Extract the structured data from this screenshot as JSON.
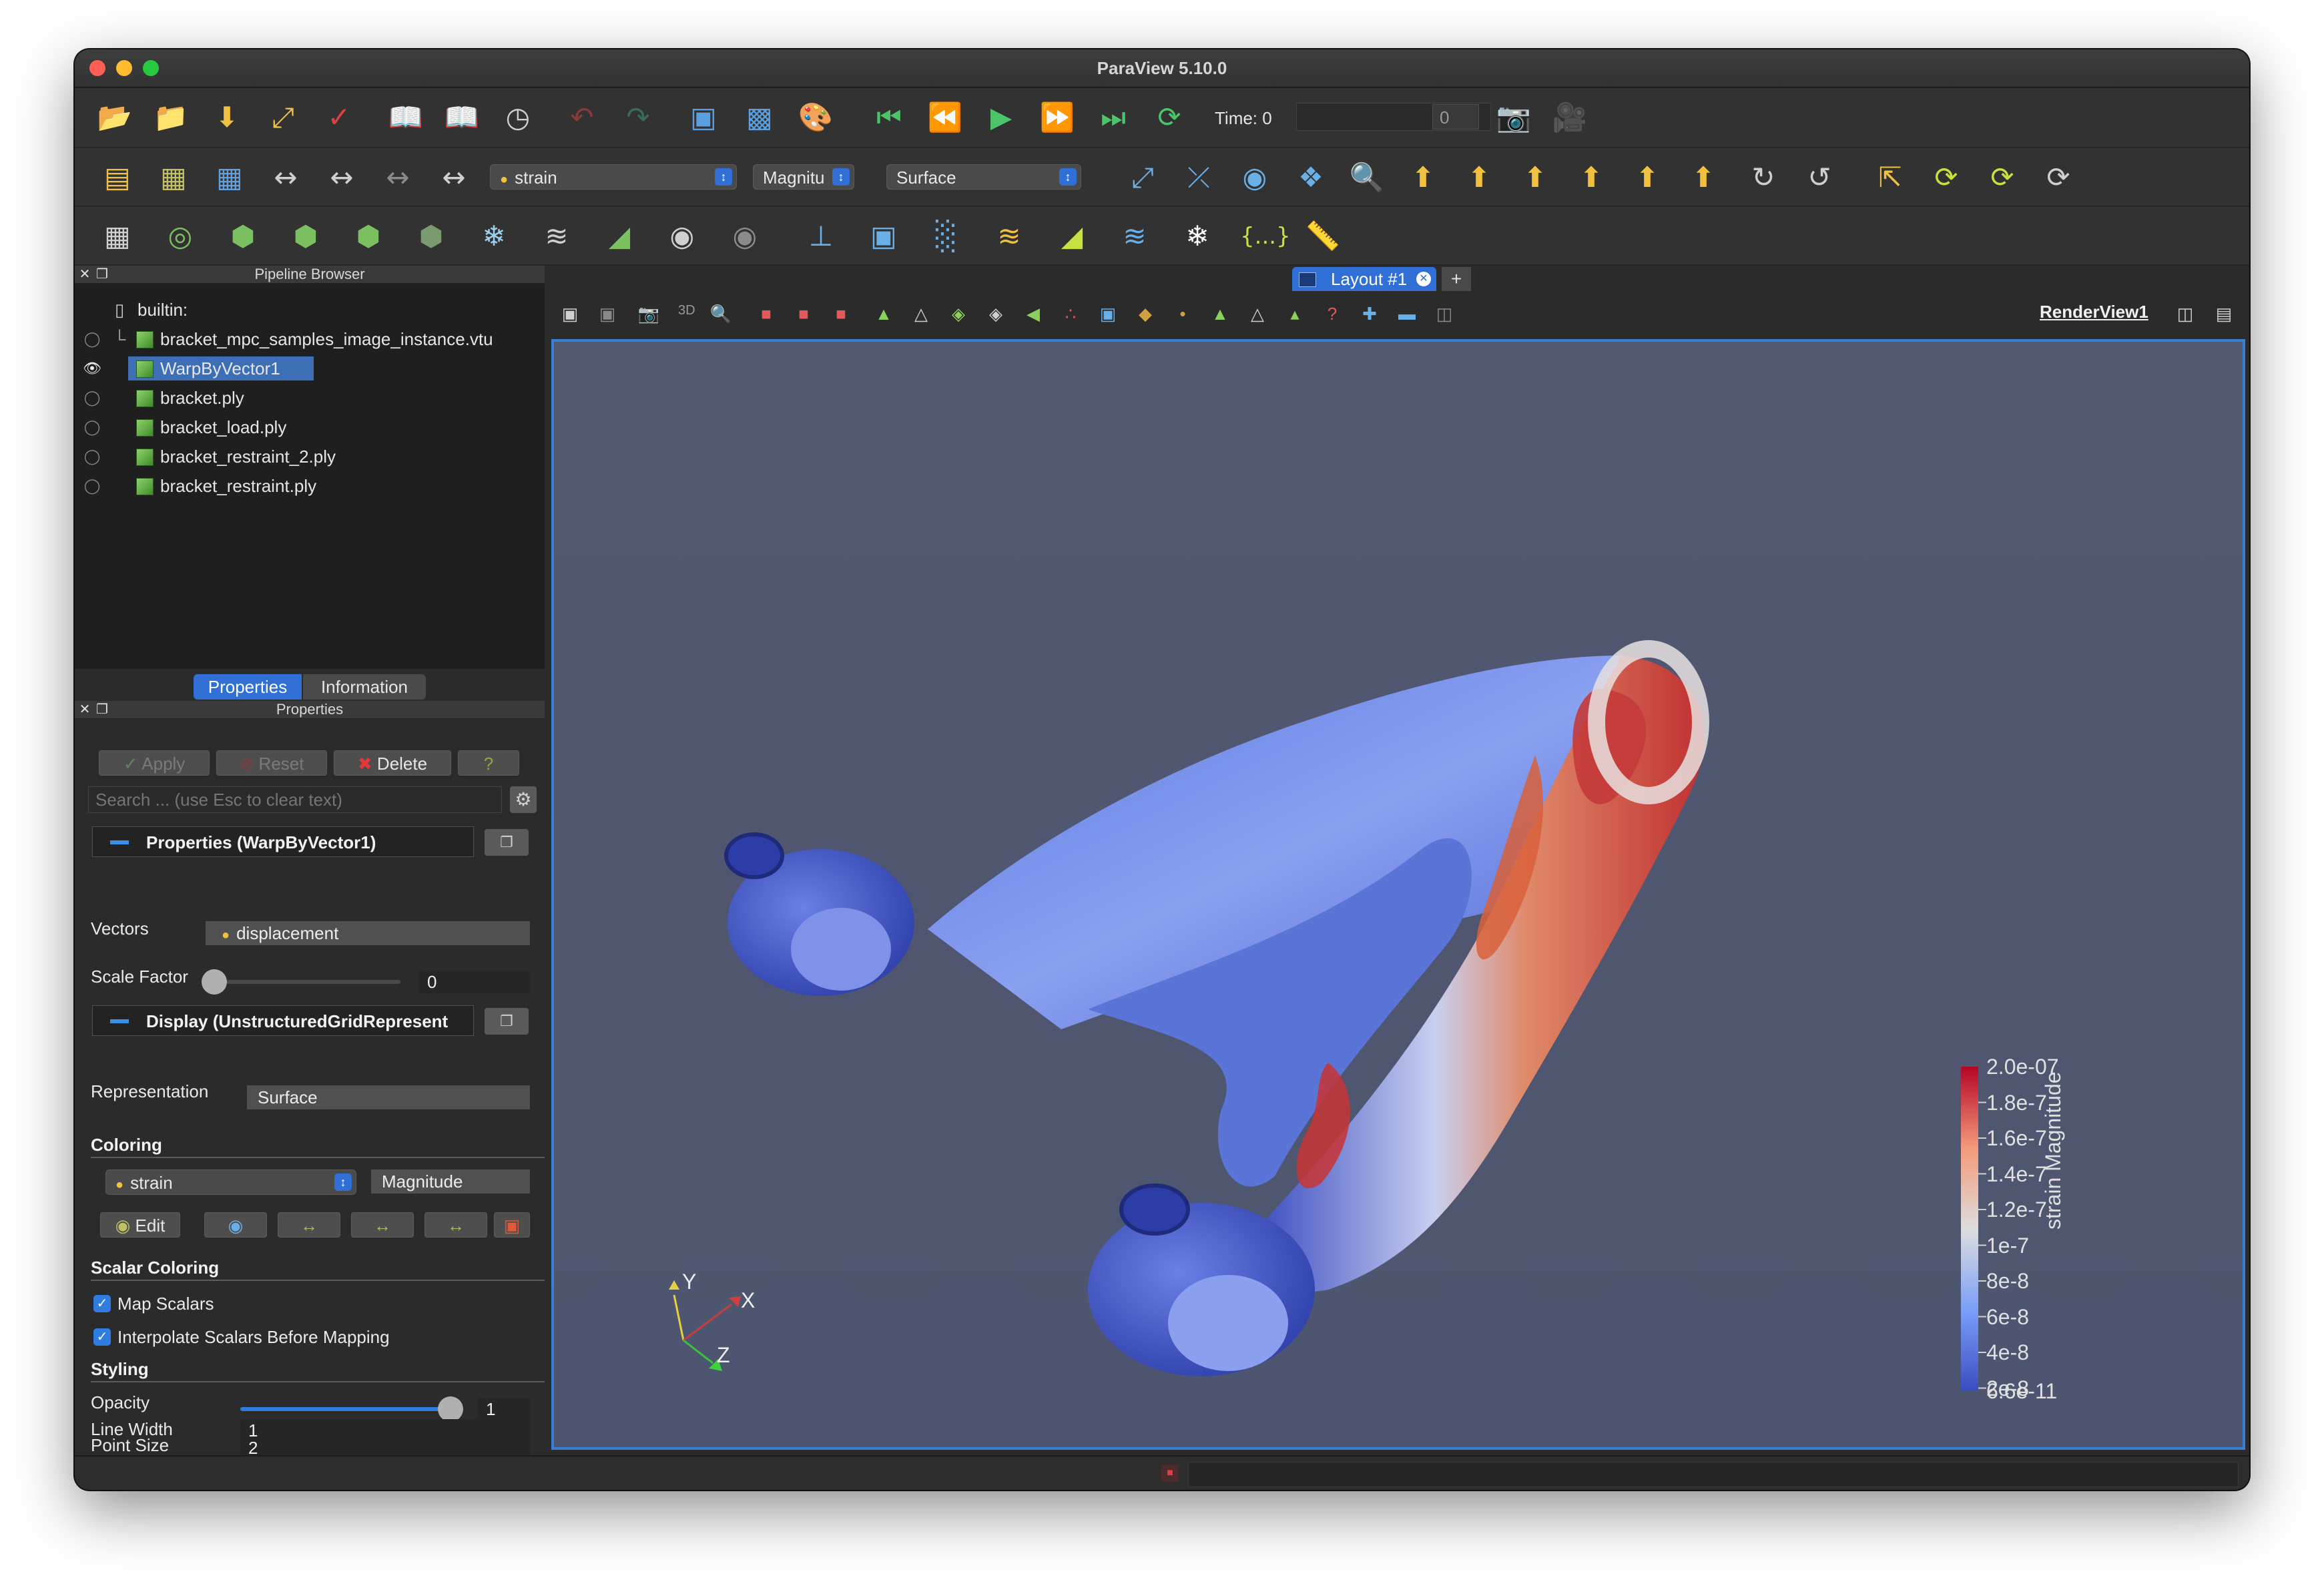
{
  "window": {
    "title": "ParaView 5.10.0",
    "traffic_lights": [
      "#ff5f57",
      "#febc2e",
      "#28c840"
    ]
  },
  "toolbar1": {
    "icons": [
      "open-folder-icon",
      "open-recent-icon",
      "save-data-icon",
      "connect-icon",
      "paraview-logo-icon",
      "load-state-icon",
      "save-state-icon",
      "time-inspector-icon",
      "undo-icon",
      "redo-icon",
      "camera-undo-icon",
      "camera-redo-icon",
      "palette-icon",
      "first-frame-icon",
      "previous-frame-icon",
      "play-icon",
      "next-frame-icon",
      "last-frame-icon",
      "loop-icon",
      "screenshot-icon",
      "save-animation-icon"
    ],
    "time_label": "Time: 0",
    "time_index": "0"
  },
  "toolbar2": {
    "color_array": "strain",
    "component": "Magnitu",
    "representation": "Surface",
    "icons": [
      "color-map-editor-icon",
      "rescale-range-icon",
      "rescale-custom-icon",
      "rescale-visible-icon",
      "rescale-temporal-icon",
      "reset-camera-icon",
      "zoom-to-data-icon",
      "zoom-to-box-icon",
      "view-plus-x-icon",
      "view-minus-x-icon",
      "view-plus-y-icon",
      "view-minus-y-icon",
      "view-plus-z-icon",
      "view-minus-z-icon",
      "rotate-plus-90-icon",
      "rotate-minus-90-icon",
      "center-axes-icon",
      "reset-center-icon",
      "pick-center-icon",
      "show-center-icon"
    ],
    "rotate_labels": [
      "+X",
      "-X",
      "+Y",
      "-Y",
      "+Z",
      "-Z",
      "+90",
      "-90"
    ]
  },
  "toolbar3": {
    "icons": [
      "calculator-icon",
      "contour-icon",
      "clip-icon",
      "slice-icon",
      "threshold-icon",
      "extract-subset-icon",
      "glyph-icon",
      "stream-tracer-icon",
      "warp-by-vector-icon",
      "group-datasets-icon",
      "extract-level-icon",
      "probe-icon",
      "plot-over-line-icon",
      "histogram-icon",
      "plot-data-icon",
      "find-data-icon",
      "python-calculator-icon",
      "annotate-icon",
      "programmable-icon",
      "ruler-icon"
    ]
  },
  "pipeline_browser": {
    "header": "Pipeline Browser",
    "root": "builtin:",
    "items": [
      {
        "label": "bracket_mpc_samples_image_instance.vtu",
        "visible": false,
        "selected": false
      },
      {
        "label": "WarpByVector1",
        "visible": true,
        "selected": true
      },
      {
        "label": "bracket.ply",
        "visible": false,
        "selected": false
      },
      {
        "label": "bracket_load.ply",
        "visible": false,
        "selected": false
      },
      {
        "label": "bracket_restraint_2.ply",
        "visible": false,
        "selected": false
      },
      {
        "label": "bracket_restraint.ply",
        "visible": false,
        "selected": false
      }
    ]
  },
  "panel_tabs": {
    "properties": "Properties",
    "information": "Information"
  },
  "properties": {
    "header": "Properties",
    "apply": "Apply",
    "reset": "Reset",
    "delete": "Delete",
    "help": "?",
    "search_placeholder": "Search ... (use Esc to clear text)",
    "group_properties": "Properties (WarpByVector1)",
    "vectors_label": "Vectors",
    "vectors_value": "displacement",
    "scale_factor_label": "Scale Factor",
    "scale_factor_value": "0",
    "group_display": "Display (UnstructuredGridRepresent",
    "representation_label": "Representation",
    "representation_value": "Surface",
    "coloring_section": "Coloring",
    "coloring_array": "strain",
    "coloring_component": "Magnitude",
    "edit_label": "Edit",
    "scalar_coloring_section": "Scalar Coloring",
    "map_scalars": "Map Scalars",
    "interpolate_scalars": "Interpolate Scalars Before Mapping",
    "styling_section": "Styling",
    "opacity_label": "Opacity",
    "opacity_value": "1",
    "point_size_label": "Point Size",
    "point_size_value": "2",
    "line_width_label": "Line Width",
    "line_width_value": "1"
  },
  "layout": {
    "tab_label": "Layout #1",
    "add_tab": "+",
    "view_name": "RenderView1",
    "view_toolbar_3d": "3D"
  },
  "render_view": {
    "background": "#525870",
    "axes": {
      "x": "X",
      "y": "Y",
      "z": "Z"
    },
    "colorbar": {
      "title": "strain Magnitude",
      "max_label": "2.0e-07",
      "min_label": "6.6e-11",
      "ticks": [
        "1.8e-7",
        "1.6e-7",
        "1.4e-7",
        "1.2e-7",
        "1e-7",
        "8e-8",
        "6e-8",
        "4e-8",
        "2e-8"
      ]
    }
  },
  "colors": {
    "accent": "#2f7de1",
    "low": "#3b4cc0",
    "high": "#b40426",
    "selection": "#3d6fb6"
  }
}
